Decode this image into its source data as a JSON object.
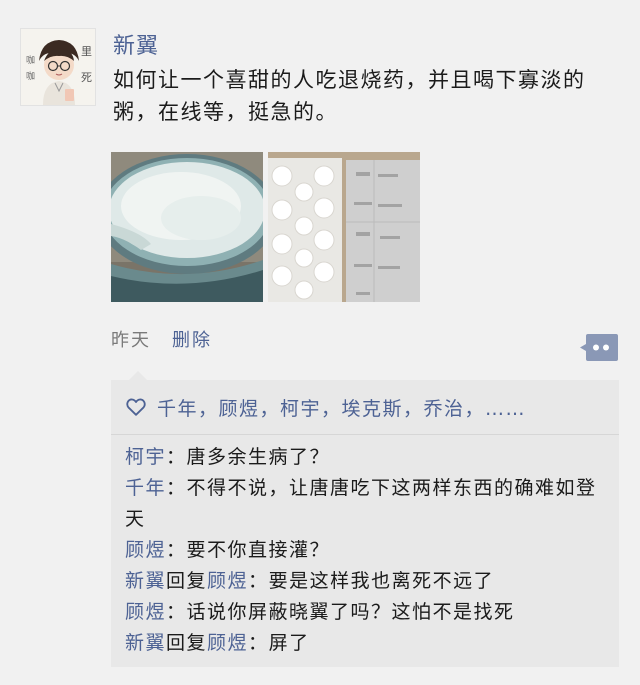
{
  "post": {
    "author": "新翼",
    "text": "如何让一个喜甜的人吃退烧药，并且喝下寡淡的粥，在线等，挺急的。",
    "images": [
      {
        "icon": "porridge-bowl-image"
      },
      {
        "icon": "pill-blister-image"
      }
    ],
    "time": "昨天",
    "delete_label": "删除"
  },
  "avatar": {
    "left_chars": "咖\n咖",
    "right_chars": "里\n死"
  },
  "likes": {
    "icon": "heart-icon",
    "names": "千年，顾煜，柯宇，埃克斯，乔治，……"
  },
  "comments": [
    {
      "name": "柯宇",
      "reply_label": "",
      "reply_to": "",
      "sep": "：",
      "text": "唐多余生病了？"
    },
    {
      "name": "千年",
      "reply_label": "",
      "reply_to": "",
      "sep": "：",
      "text": "不得不说，让唐唐吃下这两样东西的确难如登天"
    },
    {
      "name": "顾煜",
      "reply_label": "",
      "reply_to": "",
      "sep": "：",
      "text": "要不你直接灌？"
    },
    {
      "name": "新翼",
      "reply_label": "回复",
      "reply_to": "顾煜",
      "sep": "：",
      "text": "要是这样我也离死不远了"
    },
    {
      "name": "顾煜",
      "reply_label": "",
      "reply_to": "",
      "sep": "：",
      "text": "话说你屏蔽晓翼了吗？这怕不是找死"
    },
    {
      "name": "新翼",
      "reply_label": "回复",
      "reply_to": "顾煜",
      "sep": "：",
      "text": "屏了"
    }
  ],
  "colors": {
    "name_link": "#4d6294",
    "background": "#f1f1f1",
    "comment_box": "#e8e8e8",
    "more_button": "#8a98b6"
  }
}
